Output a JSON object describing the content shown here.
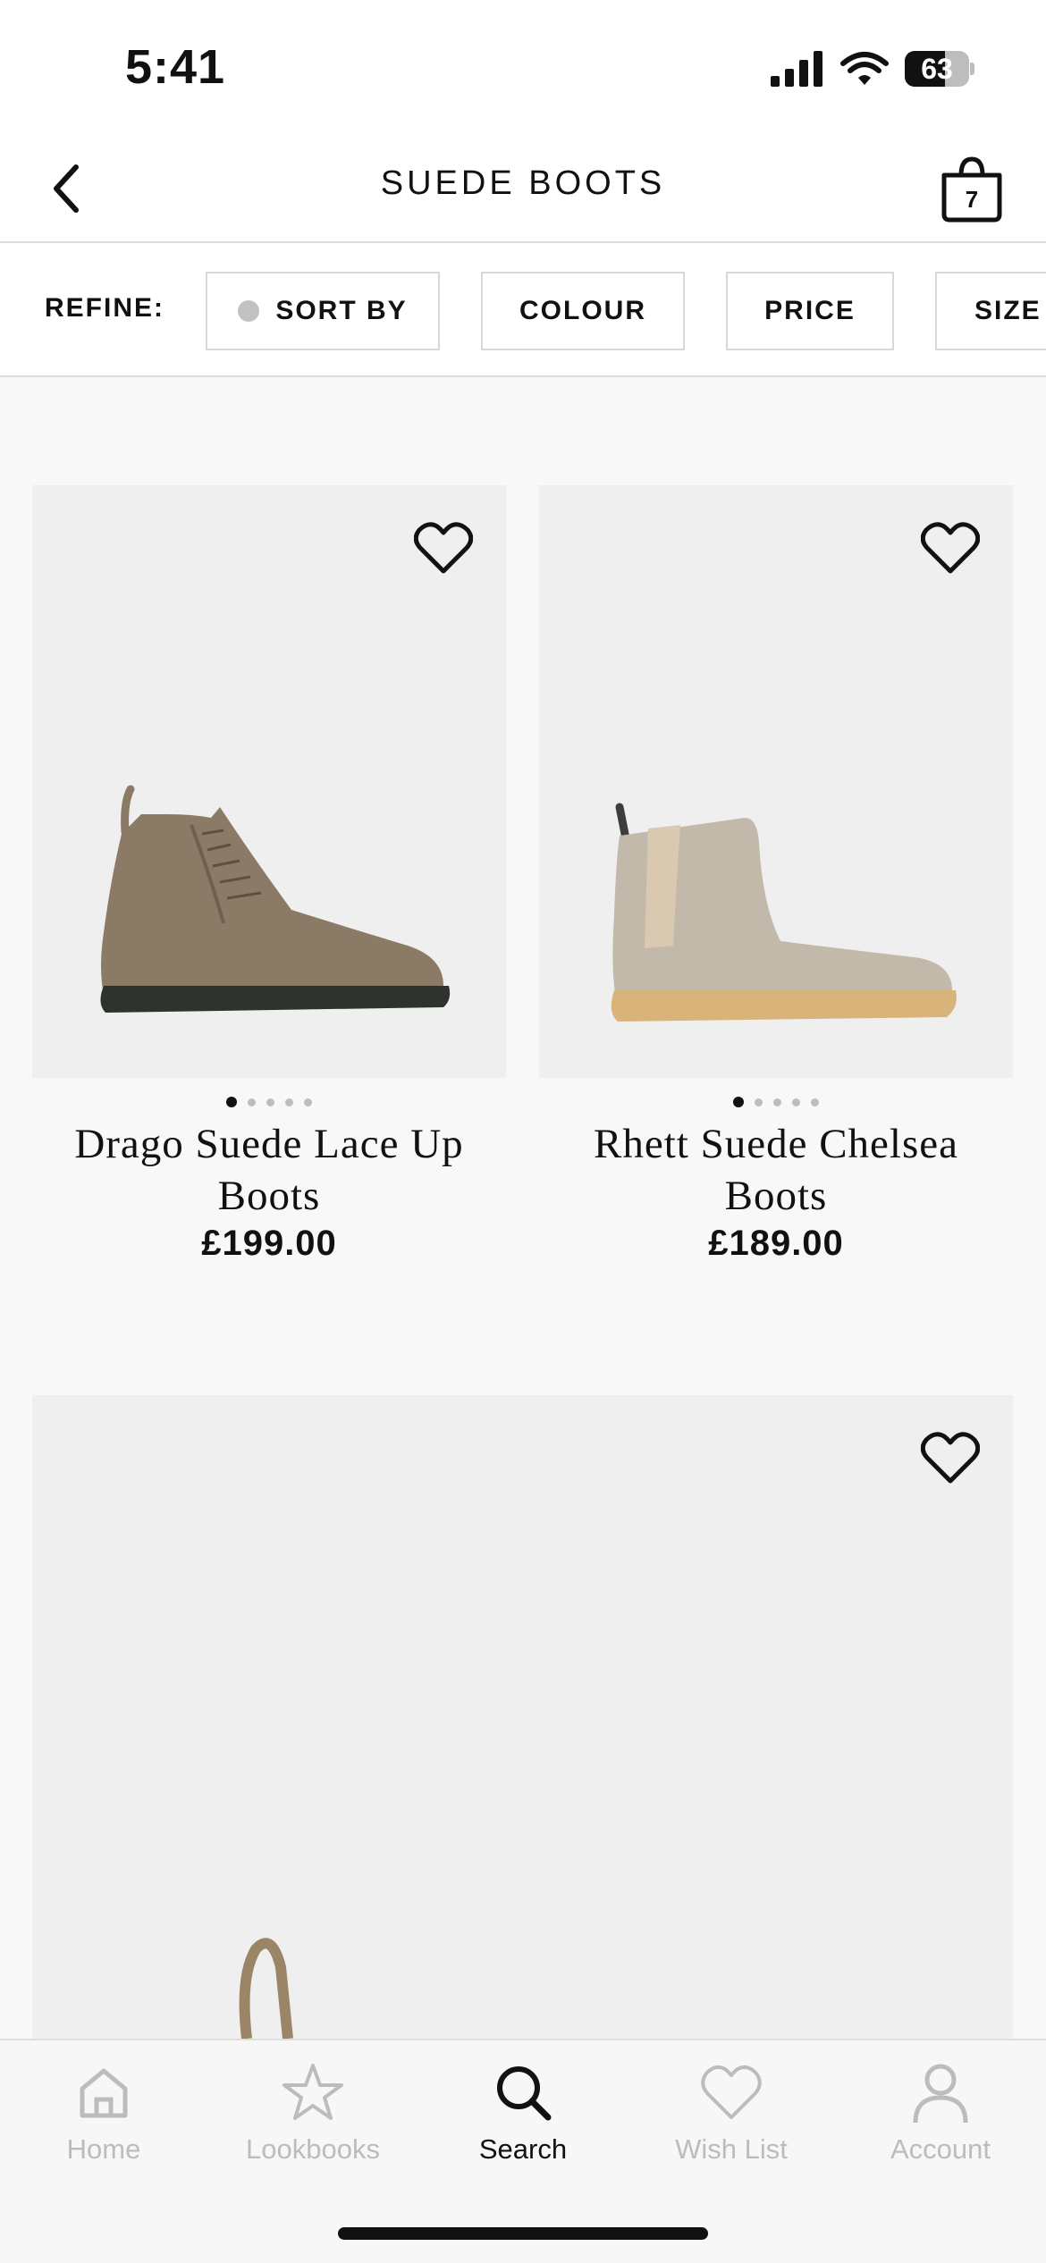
{
  "status_bar": {
    "time": "5:41",
    "battery": "63",
    "battery_level": 0.63
  },
  "header": {
    "title": "SUEDE BOOTS",
    "bag_count": "7"
  },
  "refine": {
    "label": "REFINE:",
    "chips": [
      "SORT BY",
      "COLOUR",
      "PRICE",
      "SIZE"
    ]
  },
  "products": [
    {
      "name_line1": "Drago Suede Lace Up",
      "name_line2": "Boots",
      "price": "£199.00",
      "image_count": 5,
      "active_image": 1,
      "boot_color": "#8b7b66"
    },
    {
      "name_line1": "Rhett Suede Chelsea",
      "name_line2": "Boots",
      "price": "£189.00",
      "image_count": 5,
      "active_image": 1,
      "boot_color": "#c3b9aa"
    },
    {
      "boot_color": "#9a8566"
    }
  ],
  "tabs": [
    {
      "label": "Home",
      "icon": "home-icon"
    },
    {
      "label": "Lookbooks",
      "icon": "star-icon"
    },
    {
      "label": "Search",
      "icon": "search-icon",
      "active": true
    },
    {
      "label": "Wish List",
      "icon": "heart-icon"
    },
    {
      "label": "Account",
      "icon": "account-icon"
    }
  ]
}
